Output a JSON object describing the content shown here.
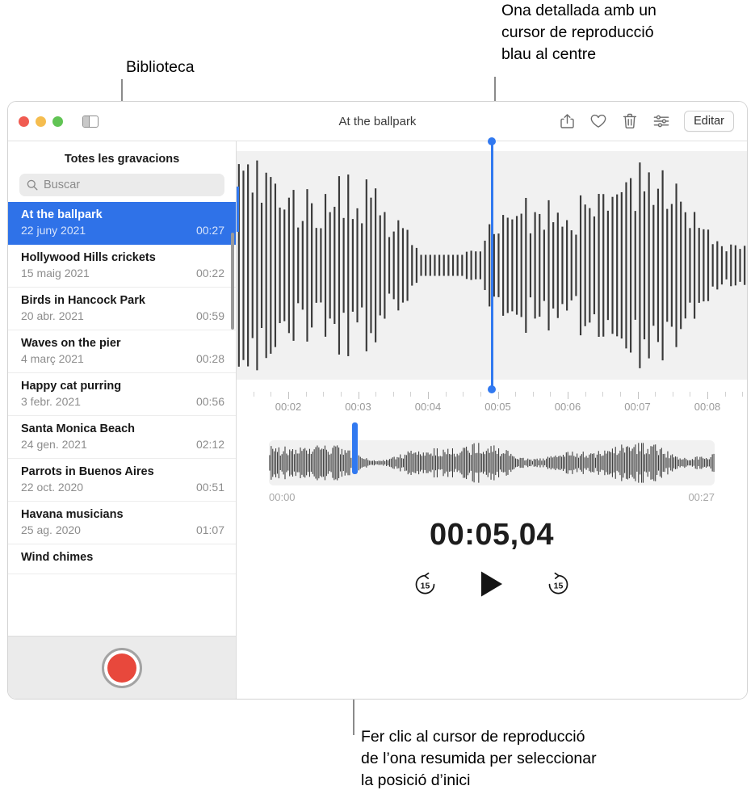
{
  "callouts": {
    "library": "Biblioteca",
    "detailed_wave": "Ona detallada amb un\ncursor de reproducció\nblau al centre",
    "overview_wave": "Fer clic al cursor de reproducció\nde l’ona resumida per seleccionar\nla posició d’inici"
  },
  "window": {
    "title": "At the ballpark",
    "toolbar": {
      "share_icon": "share-icon",
      "favorite_icon": "heart-icon",
      "delete_icon": "trash-icon",
      "enhance_icon": "sliders-icon",
      "edit_label": "Editar",
      "sidebar_toggle_icon": "sidebar-toggle-icon"
    }
  },
  "sidebar": {
    "header": "Totes les gravacions",
    "search_placeholder": "Buscar",
    "recordings": [
      {
        "title": "At the ballpark",
        "date": "22 juny 2021",
        "duration": "00:27",
        "selected": true
      },
      {
        "title": "Hollywood Hills crickets",
        "date": "15 maig 2021",
        "duration": "00:22",
        "selected": false
      },
      {
        "title": "Birds in Hancock Park",
        "date": "20 abr. 2021",
        "duration": "00:59",
        "selected": false
      },
      {
        "title": "Waves on the pier",
        "date": "4 març 2021",
        "duration": "00:28",
        "selected": false
      },
      {
        "title": "Happy cat purring",
        "date": "3 febr. 2021",
        "duration": "00:56",
        "selected": false
      },
      {
        "title": "Santa Monica Beach",
        "date": "24 gen. 2021",
        "duration": "02:12",
        "selected": false
      },
      {
        "title": "Parrots in Buenos Aires",
        "date": "22 oct. 2020",
        "duration": "00:51",
        "selected": false
      },
      {
        "title": "Havana musicians",
        "date": "25 ag. 2020",
        "duration": "01:07",
        "selected": false
      },
      {
        "title": "Wind chimes",
        "date": "",
        "duration": "",
        "selected": false
      }
    ],
    "record_button_icon": "record-icon"
  },
  "player": {
    "ruler_labels": [
      "00:02",
      "00:03",
      "00:04",
      "00:05",
      "00:06",
      "00:07",
      "00:08"
    ],
    "overview_start": "00:00",
    "overview_end": "00:27",
    "timecode": "00:05,04",
    "detail_playhead_position_pct": 49.8,
    "overview_playhead_position_pct": 18.6,
    "transport": {
      "skip_back_label": "15",
      "skip_back_icon": "skip-back-15-icon",
      "play_icon": "play-icon",
      "skip_forward_label": "15",
      "skip_forward_icon": "skip-forward-15-icon"
    }
  },
  "colors": {
    "accent_blue": "#2f72e8",
    "playhead_blue": "#3179f0",
    "record_red": "#e8483c",
    "wave_bg": "#f1f1f1"
  }
}
